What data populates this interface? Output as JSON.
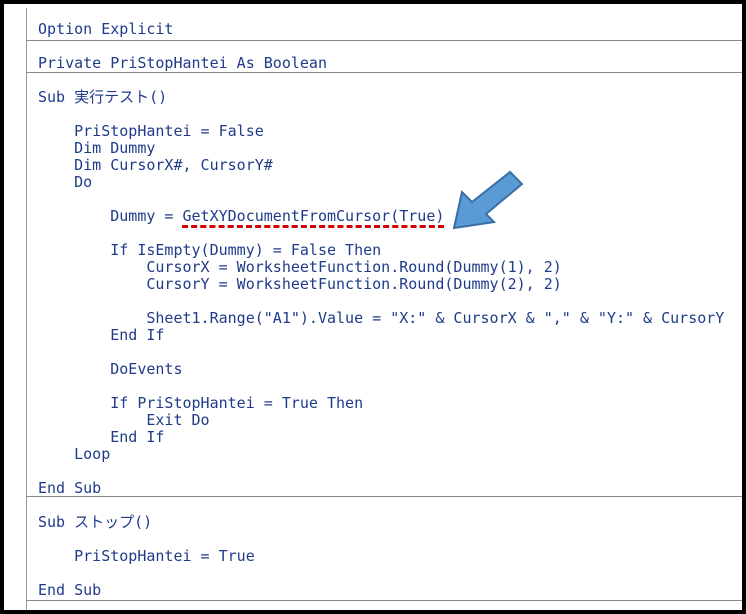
{
  "code": {
    "lines": [
      "Option Explicit",
      "Private PriStopHantei As Boolean",
      "Sub 実行テスト()",
      "    PriStopHantei = False",
      "    Dim Dummy",
      "    Dim CursorX#, CursorY#",
      "    Do",
      "        Dummy = GetXYDocumentFromCursor(True)",
      "        If IsEmpty(Dummy) = False Then",
      "            CursorX = WorksheetFunction.Round(Dummy(1), 2)",
      "            CursorY = WorksheetFunction.Round(Dummy(2), 2)",
      "            Sheet1.Range(\"A1\").Value = \"X:\" & CursorX & \",\" & \"Y:\" & CursorY",
      "        End If",
      "        DoEvents",
      "        If PriStopHantei = True Then",
      "            Exit Do",
      "        End If",
      "    Loop",
      "End Sub",
      "Sub ストップ()",
      "    PriStopHantei = True",
      "End Sub"
    ]
  },
  "annotation": {
    "underline_color": "#d40000",
    "arrow_color": "#5b9bd5",
    "arrow_icon": "arrow-pointing-down-left"
  }
}
